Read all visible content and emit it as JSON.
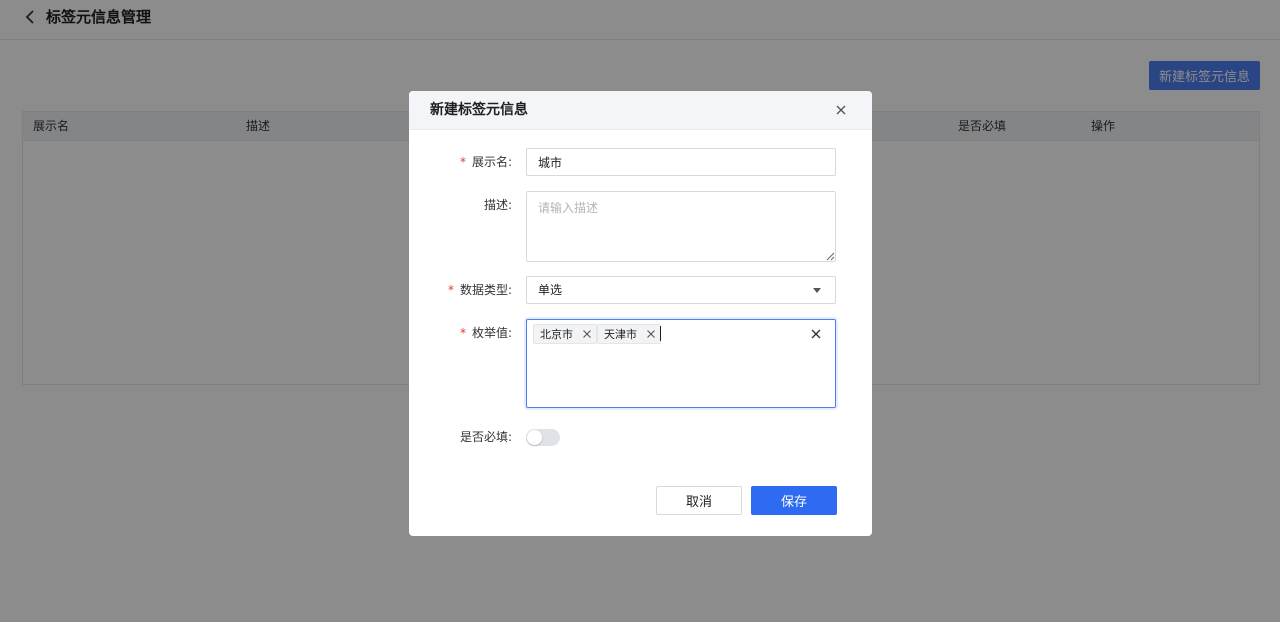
{
  "page": {
    "title": "标签元信息管理",
    "new_button_label": "新建标签元信息"
  },
  "table": {
    "columns": [
      "展示名",
      "描述",
      "是否必填",
      "操作"
    ]
  },
  "modal": {
    "title": "新建标签元信息",
    "fields": {
      "display_name": {
        "label": "展示名:",
        "required": "*",
        "value": "城市"
      },
      "description": {
        "label": "描述:",
        "placeholder": "请输入描述",
        "value": ""
      },
      "data_type": {
        "label": "数据类型:",
        "required": "*",
        "value": "单选"
      },
      "enum_values": {
        "label": "枚举值:",
        "required": "*",
        "tags": [
          "北京市",
          "天津市"
        ]
      },
      "required_switch": {
        "label": "是否必填:",
        "on": false
      }
    },
    "buttons": {
      "cancel": "取消",
      "save": "保存"
    }
  },
  "colors": {
    "primary": "#2f6bf2",
    "required_mark": "#e5372e",
    "overlay": "rgba(0,0,0,0.45)"
  }
}
